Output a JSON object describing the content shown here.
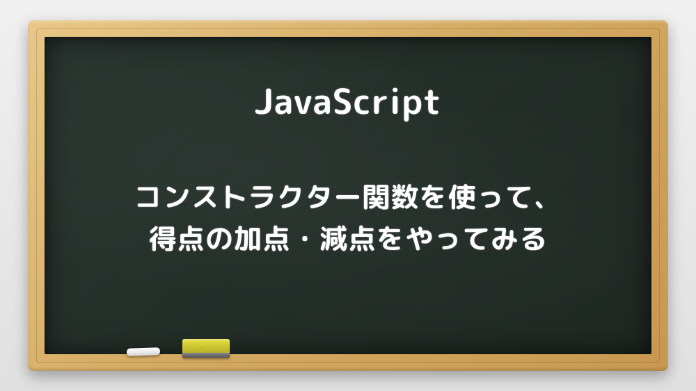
{
  "title": "JavaScript",
  "subtitle_line1": "コンストラクター関数を使って、",
  "subtitle_line2": "得点の加点・減点をやってみる"
}
